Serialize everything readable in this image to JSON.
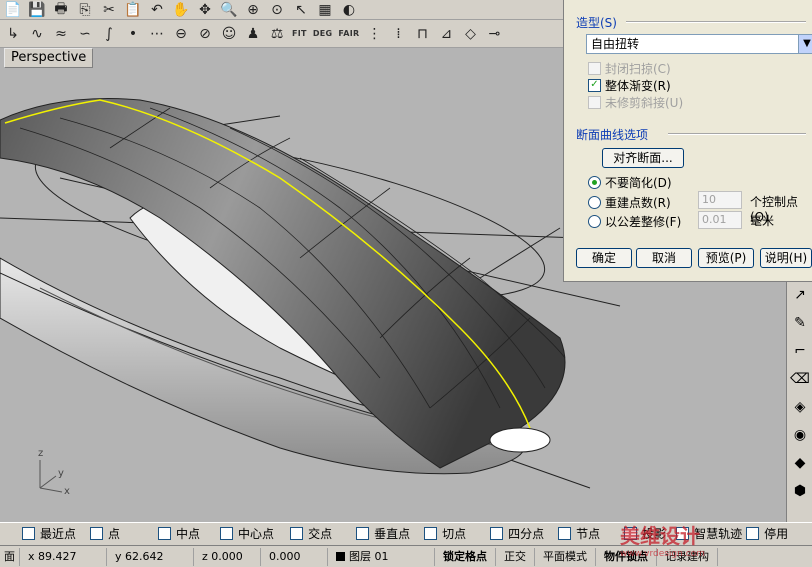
{
  "viewport": {
    "label": "Perspective",
    "axes": {
      "z": "z",
      "y": "y",
      "x": "x"
    }
  },
  "dialog": {
    "shape_label": "造型(S)",
    "shape_value": "自由扭转",
    "options": [
      {
        "label": "封闭扫掠(C)",
        "checked": false,
        "disabled": true
      },
      {
        "label": "整体渐变(R)",
        "checked": true,
        "disabled": false
      },
      {
        "label": "未修剪斜接(U)",
        "checked": false,
        "disabled": true
      }
    ],
    "section_label": "断面曲线选项",
    "align_button": "对齐断面...",
    "radio": {
      "no_simplify": "不要简化(D)",
      "rebuild": "重建点数(R)",
      "refit": "以公差整修(F)"
    },
    "rebuild_value": "10",
    "rebuild_unit": "个控制点(O)",
    "refit_value": "0.01",
    "refit_unit": "毫米",
    "buttons": {
      "ok": "确定",
      "cancel": "取消",
      "preview": "预览(P)",
      "help": "说明(H)"
    }
  },
  "osnap": [
    "最近点",
    "点",
    "中点",
    "中心点",
    "交点",
    "垂直点",
    "切点",
    "四分点",
    "节点",
    "投影",
    "智慧轨迹",
    "停用"
  ],
  "status": {
    "prefix": "面",
    "x": "x 89.427",
    "y": "y 62.642",
    "z": "z 0.000",
    "w": "0.000",
    "layer": "图层 01",
    "grid_snap": "锁定格点",
    "ortho": "正交",
    "planar": "平面模式",
    "obj_snap": "物件锁点",
    "history": "记录建构"
  },
  "watermark": {
    "brand": "美维设计",
    "url": "www.vrdesign.com"
  }
}
